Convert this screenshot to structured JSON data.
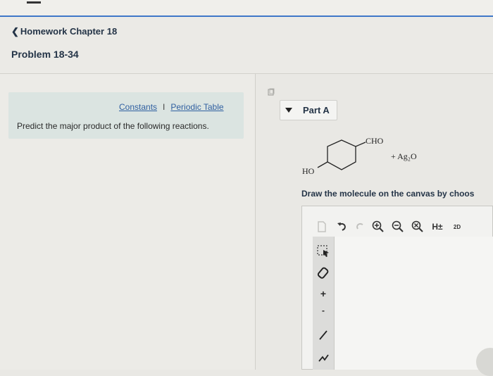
{
  "header": {
    "back_label": "Homework Chapter 18",
    "problem_title": "Problem 18-34"
  },
  "info": {
    "constants_link": "Constants",
    "separator": "I",
    "periodic_table_link": "Periodic Table",
    "prompt": "Predict the major product of the following reactions."
  },
  "part": {
    "label": "Part A"
  },
  "reaction": {
    "aldehyde_label": "CHO",
    "hydroxyl_label": "HO",
    "reagent": "+ Ag₂O"
  },
  "instructions": {
    "text": "Draw the molecule on the canvas by choos"
  },
  "toolbar": {
    "h_label": "H±",
    "mode_label": "2D"
  },
  "left_tools": {
    "plus_label": "+",
    "dot_label": "-"
  },
  "colors": {
    "accent_blue": "#3f78c8",
    "link_blue": "#2f5fa0",
    "info_bg": "#dbe4e1",
    "text_dark": "#243447"
  }
}
